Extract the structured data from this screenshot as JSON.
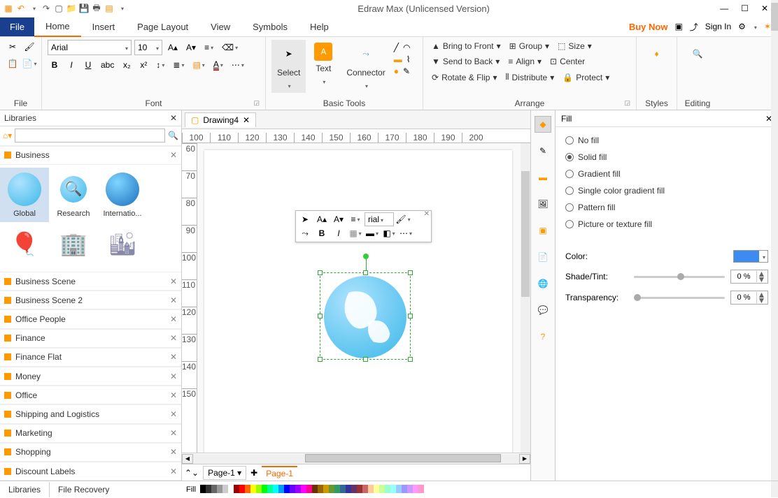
{
  "title": "Edraw Max (Unlicensed Version)",
  "buynow": "Buy Now",
  "signin": "Sign In",
  "menu": {
    "file": "File",
    "tabs": [
      "Home",
      "Insert",
      "Page Layout",
      "View",
      "Symbols",
      "Help"
    ],
    "active": "Home"
  },
  "ribbon": {
    "file_group": "File",
    "font": {
      "family": "Arial",
      "size": "10",
      "label": "Font"
    },
    "basic": {
      "select": "Select",
      "text": "Text",
      "connector": "Connector",
      "label": "Basic Tools"
    },
    "arrange": {
      "bring_front": "Bring to Front",
      "send_back": "Send to Back",
      "rotate": "Rotate & Flip",
      "group": "Group",
      "align": "Align",
      "distribute": "Distribute",
      "size": "Size",
      "center": "Center",
      "protect": "Protect",
      "label": "Arrange"
    },
    "styles": "Styles",
    "editing": "Editing"
  },
  "libraries": {
    "title": "Libraries",
    "search_ph": "",
    "categories": [
      "Business",
      "Business Scene",
      "Business Scene 2",
      "Office People",
      "Finance",
      "Finance Flat",
      "Money",
      "Office",
      "Shipping and Logistics",
      "Marketing",
      "Shopping",
      "Discount Labels"
    ],
    "shapes": [
      "Global",
      "Research",
      "Internatio...",
      "",
      "",
      ""
    ],
    "bottom": {
      "lib": "Libraries",
      "rec": "File Recovery"
    }
  },
  "doc": {
    "name": "Drawing4",
    "page1": "Page-1",
    "page2": "Page-1",
    "hticks": [
      "100",
      "110",
      "120",
      "130",
      "140",
      "150",
      "160",
      "170",
      "180",
      "190",
      "200"
    ],
    "vticks": [
      "60",
      "70",
      "80",
      "90",
      "100",
      "110",
      "120",
      "130",
      "140",
      "150"
    ],
    "mini_font": "rial"
  },
  "fill": {
    "title": "Fill",
    "options": [
      "No fill",
      "Solid fill",
      "Gradient fill",
      "Single color gradient fill",
      "Pattern fill",
      "Picture or texture fill"
    ],
    "selected": 1,
    "color_label": "Color:",
    "color_value": "#3b8bf0",
    "shade_label": "Shade/Tint:",
    "shade_value": "0 %",
    "trans_label": "Transparency:",
    "trans_value": "0 %"
  },
  "status_fill": "Fill"
}
